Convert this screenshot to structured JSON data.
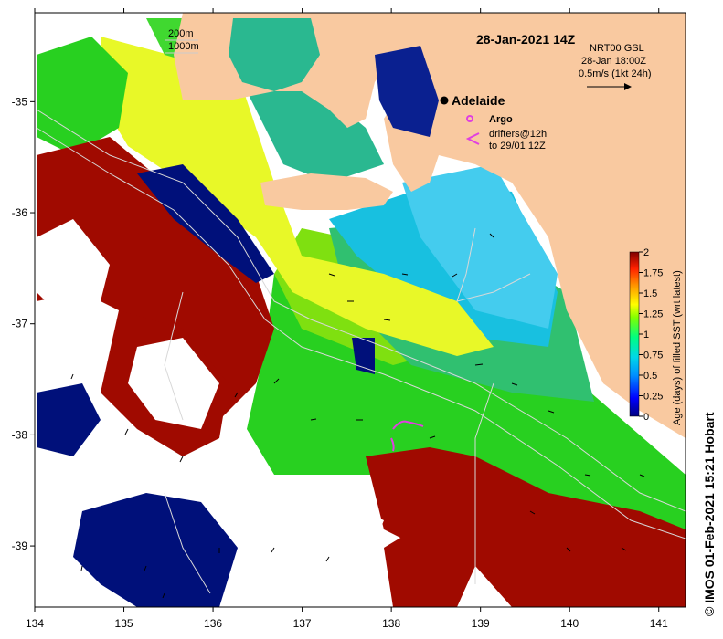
{
  "map": {
    "date_title": "28-Jan-2021 14Z",
    "credit": "© IMOS 01-Feb-2021 15:21 Hobart",
    "lon_range": [
      134,
      141.3
    ],
    "lat_range": [
      -39.55,
      -34.2
    ],
    "x_ticks": [
      "134",
      "135",
      "136",
      "137",
      "138",
      "139",
      "140",
      "141"
    ],
    "y_ticks": [
      "-35",
      "-36",
      "-37",
      "-38",
      "-39"
    ],
    "x_tick_values": [
      134,
      135,
      136,
      137,
      138,
      139,
      140,
      141
    ],
    "y_tick_values": [
      -35,
      -36,
      -37,
      -38,
      -39
    ]
  },
  "depth_legend": {
    "line1": "200m",
    "line2": "1000m"
  },
  "current_legend": {
    "line1": "NRT00 GSL",
    "line2": "28-Jan 18:00Z",
    "line3": "0.5m/s (1kt 24h)"
  },
  "place": {
    "name": "Adelaide",
    "lon": 138.6,
    "lat": -34.93
  },
  "symbols_legend": {
    "argo": "Argo",
    "drifters_line1": "drifters@12h",
    "drifters_line2": "to 29/01 12Z",
    "argo_color": "#e040e0",
    "drifter_color": "#e040e0"
  },
  "colorbar": {
    "title": "Age (days) of filled SST (wrt latest)",
    "ticks": [
      "2",
      "1.75",
      "1.5",
      "1.25",
      "1",
      "0.75",
      "0.5",
      "0.25",
      "0"
    ],
    "tick_values": [
      2,
      1.75,
      1.5,
      1.25,
      1,
      0.75,
      0.5,
      0.25,
      0
    ],
    "colors": [
      "#00007f",
      "#0000ff",
      "#0080ff",
      "#00d8e8",
      "#00ff80",
      "#80ff00",
      "#ffff00",
      "#ff8000",
      "#ff0000",
      "#7f0000"
    ]
  },
  "palette": {
    "land": "#f9c9a0",
    "no_data": "#ffffff",
    "navy": "#00107a",
    "blue": "#1e3cd0",
    "cyan": "#18b8e0",
    "teal": "#2ad0a8",
    "green_teal": "#30c878",
    "green": "#28d020",
    "lime": "#88f000",
    "yellow": "#e8f828",
    "yellow2": "#f0fa00",
    "orange": "#f08010",
    "dark_red": "#a00a00"
  }
}
